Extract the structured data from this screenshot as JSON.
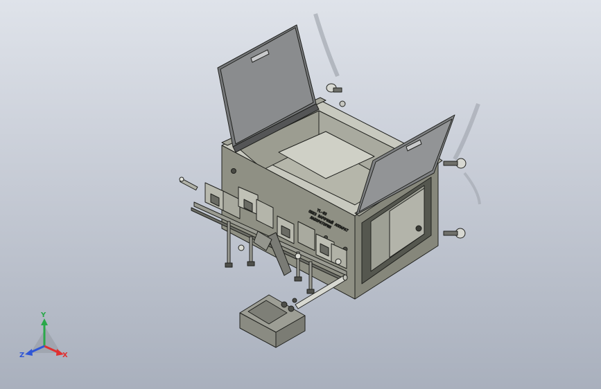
{
  "model": {
    "name_plate": {
      "line1": "YL-03",
      "line2": "ОБЕЗ ВАРОЧНЫЙ АППАРАТ",
      "line3": "ЛАБОРАТОРИЯ"
    }
  },
  "triad": {
    "x_label": "X",
    "y_label": "Y",
    "z_label": "Z",
    "colors": {
      "x": "#e03030",
      "y": "#2aa84a",
      "z": "#2f56d6"
    }
  },
  "colors": {
    "background_top": "#dfe3ea",
    "background_bottom": "#a9b0bd",
    "body": "#8b8c80",
    "body_dark": "#5f6157",
    "lid": "#7c7e7a",
    "edge": "#1f201d"
  }
}
